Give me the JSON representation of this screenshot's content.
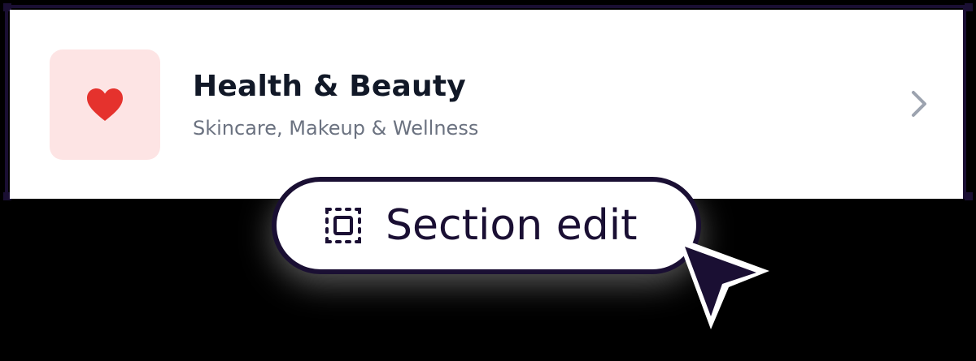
{
  "card": {
    "title": "Health & Beauty",
    "subtitle": "Skincare, Makeup & Wellness",
    "icon": "heart-icon",
    "chevron_icon": "chevron-right-icon"
  },
  "badge": {
    "label": "Section edit",
    "icon": "section-select-icon"
  },
  "cursor_icon": "pointer-cursor-icon",
  "colors": {
    "background": "#000000",
    "frame": "#1a0f33",
    "tile": "#fde4e4",
    "heart": "#e5322d",
    "title": "#111827",
    "subtitle": "#6b7280",
    "chevron": "#9ca3af"
  }
}
